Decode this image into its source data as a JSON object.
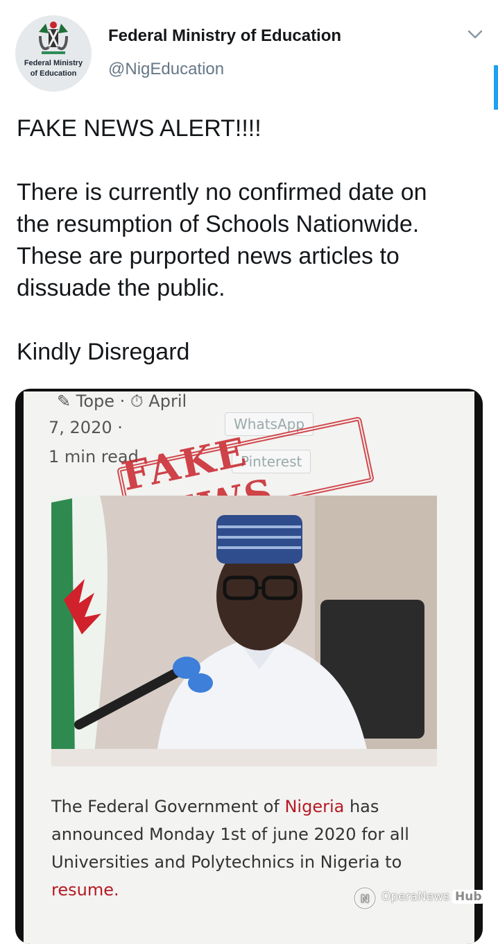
{
  "tweet": {
    "avatar_label_line1": "Federal Ministry",
    "avatar_label_line2": "of Education",
    "display_name": "Federal Ministry of Education",
    "handle": "@NigEducation",
    "text_line1": "FAKE NEWS ALERT!!!!",
    "text_line2": "There is currently no confirmed date on",
    "text_line3": "the resumption of Schools Nationwide.",
    "text_line4": "These are purported news articles to",
    "text_line5": "dissuade the public.",
    "text_line6": "Kindly Disregard"
  },
  "article": {
    "author": "Tope",
    "date_part1": "April",
    "date_part2": "7, 2020",
    "read_time": "1 min read",
    "share_whatsapp": "WhatsApp",
    "share_pinterest": "Pinterest",
    "stamp_text": "FAKE NEWS",
    "caption_line1_a": "The Federal Government of ",
    "caption_line1_b": "Nigeria",
    "caption_line1_c": " has",
    "caption_line2": "announced Monday 1st of june 2020 for all",
    "caption_line3": "Universities and Polytechnics in Nigeria to",
    "caption_line4": "resume."
  },
  "watermark": {
    "brand": "OperaNews",
    "hub": "Hub"
  },
  "colors": {
    "handle": "#657786",
    "stamp": "#c8262d",
    "caption_link": "#b51a24"
  }
}
